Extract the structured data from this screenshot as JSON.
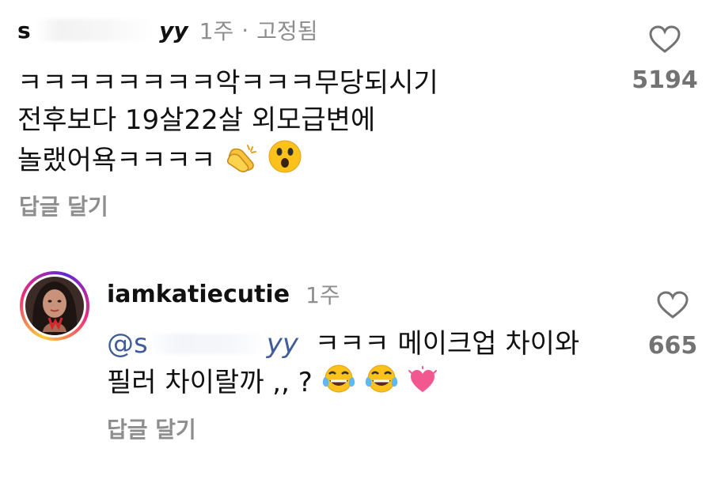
{
  "comment1": {
    "username_start": "s",
    "username_end": "yy",
    "time": "1주",
    "separator": "·",
    "pinned": "고정됨",
    "lines": [
      "ㅋㅋㅋㅋㅋㅋㅋㅋ악ㅋㅋㅋ무당되시기",
      "전후보다 19살22살 외모급변에",
      "놀랬어욕ㅋㅋㅋㅋ"
    ],
    "emojis": [
      "clapping-hands-emoji",
      "astonished-face-emoji"
    ],
    "likes": "5194",
    "reply_label": "답글 달기"
  },
  "comment2": {
    "username": "iamkatiecutie",
    "time": "1주",
    "mention_start": "@s",
    "mention_end": "yy",
    "line1_rest": "ㅋㅋㅋ 메이크업 차이와",
    "line2": "필러 차이랄까 ,, ?",
    "emojis": [
      "tears-of-joy-emoji",
      "tears-of-joy-emoji",
      "sparkling-heart-emoji"
    ],
    "likes": "665",
    "reply_label": "답글 달기"
  },
  "colors": {
    "text": "#111111",
    "muted": "#8e8e8e",
    "mention": "#3f5d9b"
  }
}
